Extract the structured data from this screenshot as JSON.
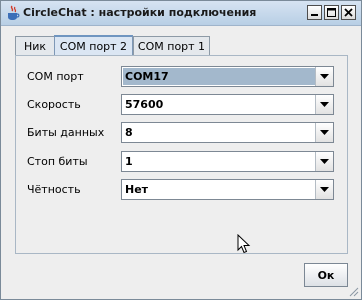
{
  "window": {
    "title": "CircleChat : настройки подключения",
    "icon": "java-cup-icon",
    "controls": [
      "minimize-icon",
      "maximize-icon",
      "close-icon"
    ]
  },
  "tabs": [
    {
      "label": "Ник",
      "active": false
    },
    {
      "label": "COM порт 2",
      "active": true
    },
    {
      "label": "COM порт 1",
      "active": false
    }
  ],
  "form": {
    "port": {
      "label": "COM порт",
      "value": "COM17"
    },
    "speed": {
      "label": "Скорость",
      "value": "57600"
    },
    "data_bits": {
      "label": "Биты данных",
      "value": "8"
    },
    "stop_bits": {
      "label": "Стоп биты",
      "value": "1"
    },
    "parity": {
      "label": "Чётность",
      "value": "Нет"
    }
  },
  "buttons": {
    "ok": "Ок"
  },
  "colors": {
    "selected_field": "#a3b8cc",
    "titlebar": "#c8daec"
  }
}
